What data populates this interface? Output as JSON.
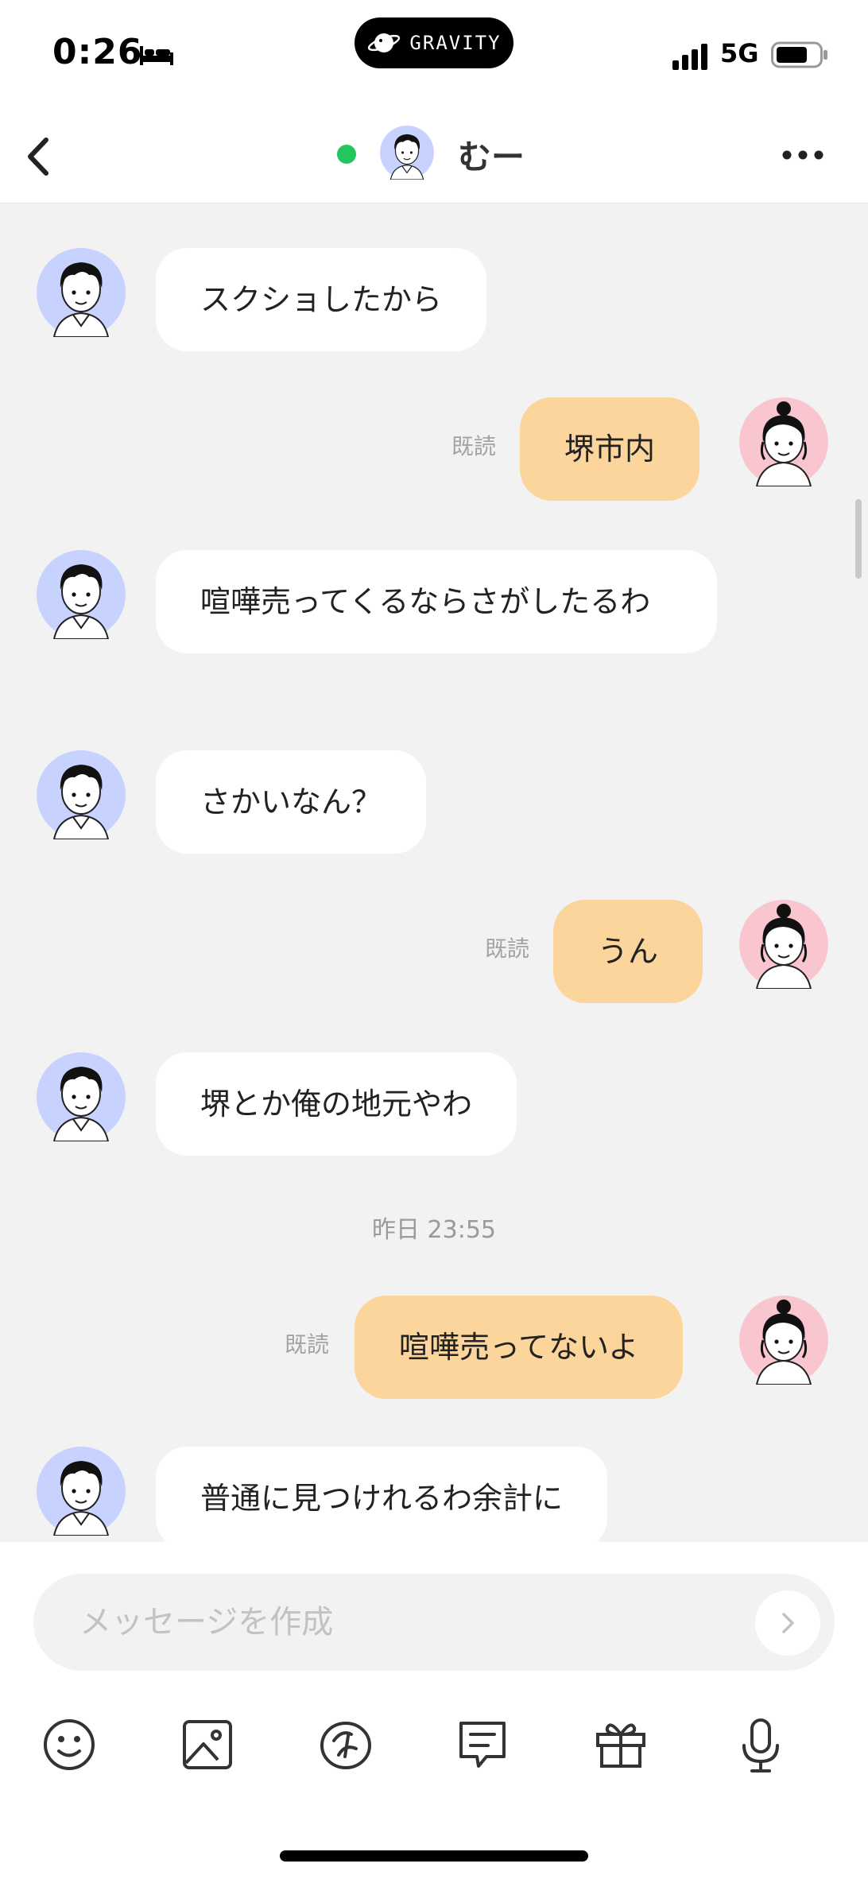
{
  "status_bar": {
    "time": "0:26",
    "island_label": "GRAVITY",
    "network": "5G",
    "icons": [
      "bed-icon",
      "signal-icon",
      "battery-icon"
    ]
  },
  "nav": {
    "name": "むー",
    "online_color": "#22c55e",
    "icons": [
      "back-icon",
      "more-icon"
    ]
  },
  "colors": {
    "outgoing_bubble": "#fcd59d",
    "incoming_bubble": "#ffffff",
    "chat_background": "#f2f2f2",
    "male_avatar_bg": "#c7d2fe",
    "female_avatar_bg": "#f9c6d0"
  },
  "messages": [
    {
      "side": "incoming",
      "text": "スクショしたから"
    },
    {
      "side": "outgoing",
      "text": "堺市内",
      "read": "既読"
    },
    {
      "side": "incoming",
      "text": "喧嘩売ってくるならさがしたるわ"
    },
    {
      "side": "incoming",
      "text": "さかいなん？"
    },
    {
      "side": "outgoing",
      "text": "うん",
      "read": "既読"
    },
    {
      "side": "incoming",
      "text": "堺とか俺の地元やわ"
    },
    {
      "timestamp": "昨日 23:55"
    },
    {
      "side": "outgoing",
      "text": "喧嘩売ってないよ",
      "read": "既読"
    },
    {
      "side": "incoming",
      "text": "普通に見つけれるわ余計に"
    }
  ],
  "composer": {
    "placeholder": "メッセージを作成",
    "value": "",
    "tools": [
      "emoji-icon",
      "image-icon",
      "sticker-icon",
      "template-message-icon",
      "gift-icon",
      "microphone-icon"
    ]
  }
}
